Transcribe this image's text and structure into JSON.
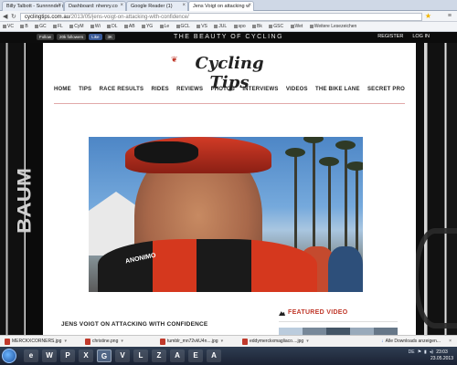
{
  "browser": {
    "tabs": [
      {
        "label": "Billy Talbott - Sunnnnder ("
      },
      {
        "label": "Dashboard: nhenry.co"
      },
      {
        "label": "Google Reader (1)"
      },
      {
        "label": "Jens Voigt on attacking w"
      }
    ],
    "url_host": "cyclingtips.com.au",
    "url_path": "/2013/05/jens-voigt-on-attacking-with-confidence/",
    "bookmarks": [
      "VC",
      "B",
      "GC",
      "FL",
      "CyM",
      "Wi",
      "DL",
      "AB",
      "YG",
      "Le",
      "GCL",
      "VS",
      "JUL",
      "spo",
      "Bk",
      "GSC",
      "Wet",
      "Weitere Lesezeichen"
    ]
  },
  "site": {
    "social": [
      "Follow",
      "20k followers",
      "Like",
      "3K"
    ],
    "tagline": "THE BEAUTY OF CYCLING",
    "user_links": [
      "REGISTER",
      "LOG IN"
    ],
    "logo": "Cycling Tips",
    "nav": [
      "HOME",
      "TIPS",
      "RACE RESULTS",
      "RIDES",
      "REVIEWS",
      "PHOTOS",
      "INTERVIEWS",
      "VIDEOS",
      "THE BIKE LANE",
      "SECRET PRO"
    ],
    "bg_brand": "BAUM",
    "video_jersey_text": "ANONIMO",
    "article_title": "JENS VOIGT ON ATTACKING WITH CONFIDENCE",
    "featured_label": "FEATURED VIDEO"
  },
  "downloads": {
    "items": [
      "MERCKXCORNERS.jpg",
      "christine.png",
      "tumblr_mn72vkU4n....jpg",
      "eddymerckxmagliaco....jpg"
    ],
    "show_all": "Alle Downloads anzeigen..."
  },
  "taskbar": {
    "apps": [
      "e",
      "W",
      "P",
      "X",
      "G",
      "V",
      "L",
      "Z",
      "A",
      "E",
      "A"
    ],
    "lang": "DE",
    "time": "23:03",
    "date": "23.05.2013"
  },
  "colors": {
    "accent": "#c0392b",
    "nav_rule": "#e1a9a9",
    "site_bar": "#0c0c0c"
  }
}
